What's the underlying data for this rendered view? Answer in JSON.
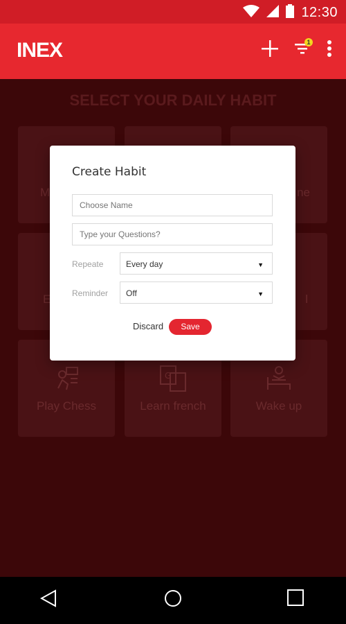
{
  "status_bar": {
    "time": "12:30"
  },
  "app_bar": {
    "logo": "INEX",
    "filter_badge_count": "1",
    "icons": {
      "add": "plus-icon",
      "filter": "filter-icon",
      "more": "more-vertical-icon"
    }
  },
  "main": {
    "title": "SELECT YOUR DAILY HABIT",
    "tiles": [
      {
        "label": "M"
      },
      {
        "label": ""
      },
      {
        "label": "ne"
      },
      {
        "label": "E"
      },
      {
        "label": ""
      },
      {
        "label": "l"
      },
      {
        "label": "Play Chess",
        "icon": "chess-player-icon"
      },
      {
        "label": "Learn french",
        "icon": "translate-icon"
      },
      {
        "label": "Wake up",
        "icon": "bed-icon"
      }
    ]
  },
  "dialog": {
    "title": "Create Habit",
    "name_placeholder": "Choose Name",
    "questions_placeholder": "Type your Questions?",
    "repeat_label": "Repeate",
    "repeat_value": "Every day",
    "reminder_label": "Reminder",
    "reminder_value": "Off",
    "discard_label": "Discard",
    "save_label": "Save"
  },
  "colors": {
    "accent": "#e7282f",
    "status_bar": "#d01d26",
    "overlay": "#3c0709"
  }
}
